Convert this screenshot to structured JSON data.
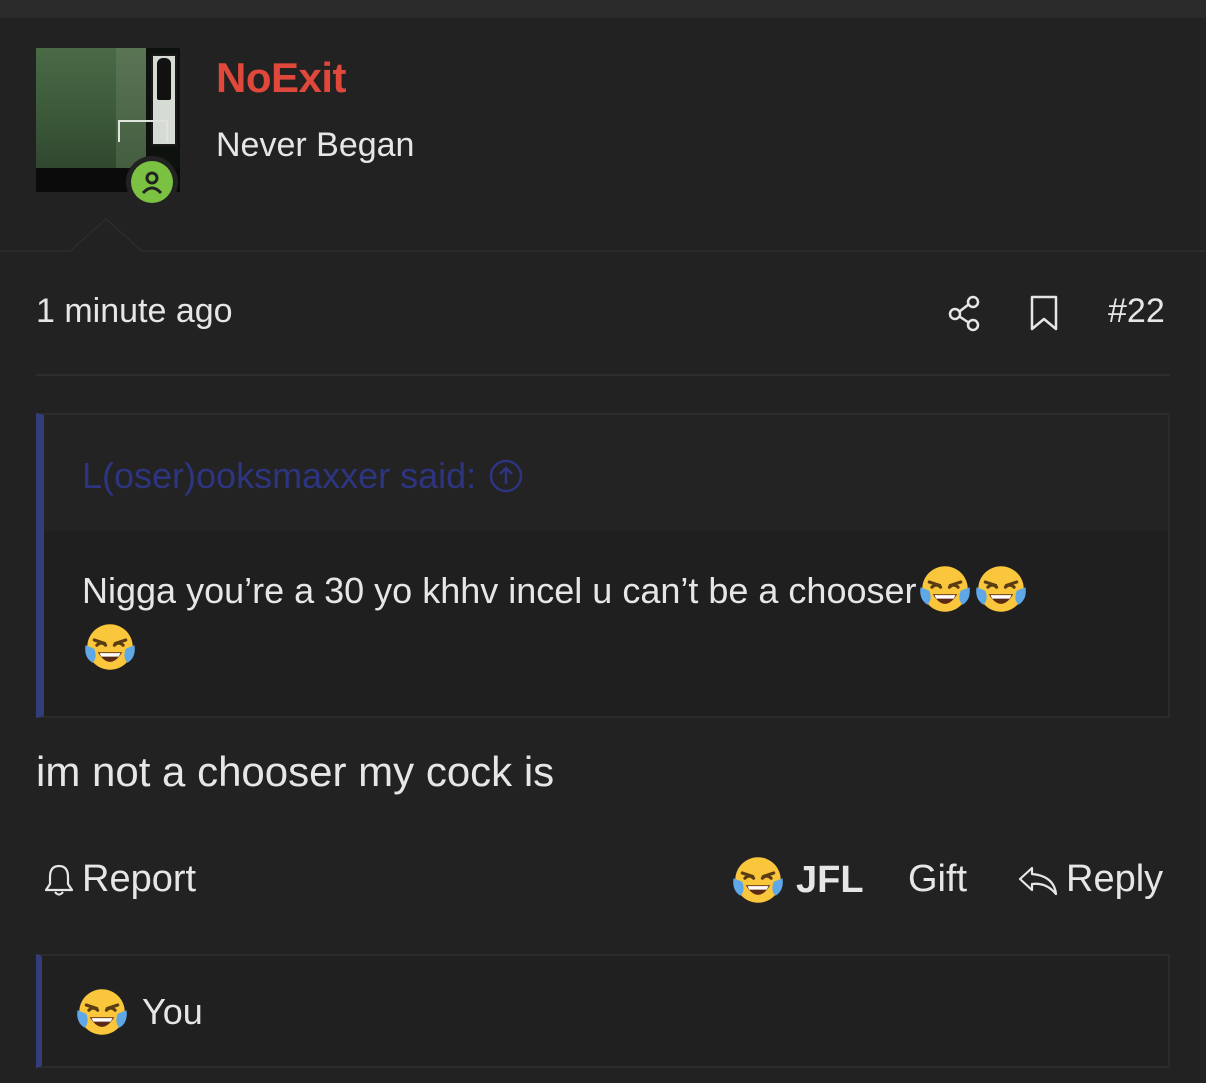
{
  "user": {
    "name": "NoExit",
    "title": "Never Began",
    "name_color": "#e0483b",
    "online_color": "#7bc242",
    "avatar_icon": "user-avatar-photo",
    "status_icon": "online-person-icon"
  },
  "post": {
    "time": "1 minute ago",
    "number": "#22",
    "share_icon": "share-icon",
    "bookmark_icon": "bookmark-icon",
    "body": "im not a chooser my cock is"
  },
  "quote": {
    "author": "L(oser)ooksmaxxer said:",
    "jump_icon": "arrow-up-circle-icon",
    "text": "Nigga you’re a 30 yo khhv incel u can’t be a chooser",
    "emojis": [
      "tears-of-joy-emoji",
      "tears-of-joy-emoji",
      "tears-of-joy-emoji"
    ],
    "accent_color": "#343d7c"
  },
  "actions": {
    "report": "Report",
    "reaction": "JFL",
    "gift": "Gift",
    "reply": "Reply",
    "report_icon": "bell-icon",
    "reaction_icon": "tears-of-joy-emoji",
    "reply_icon": "reply-arrow-icon"
  },
  "reactions_bar": {
    "label": "You",
    "icon": "tears-of-joy-emoji"
  }
}
